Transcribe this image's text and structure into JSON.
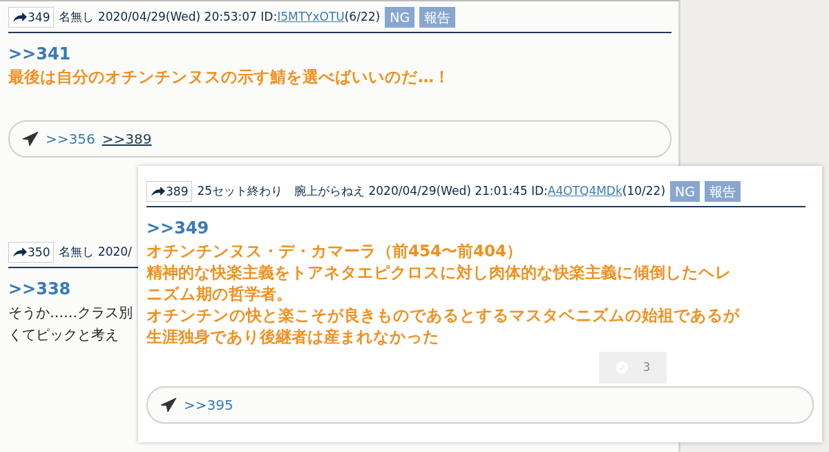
{
  "posts": [
    {
      "number": "349",
      "header": "名無し 2020/04/29(Wed) 20:53:07 ID:",
      "id": "I5MTYxOTU",
      "id_count": "(6/22)",
      "buttons": [
        "NG",
        "報告"
      ],
      "quote": ">>341",
      "kind": "highlight",
      "body": [
        "最後は自分のオチンチンヌスの示す鯖を選べばいいのだ…！"
      ],
      "replies": [
        {
          "label": ">>356",
          "active": false
        },
        {
          "label": ">>389",
          "active": true
        }
      ]
    },
    {
      "number": "350",
      "header": "名無し 2020/",
      "quote": ">>338",
      "kind": "plain",
      "body": [
        "そうか……クラス別",
        "くてピックと考え"
      ]
    }
  ],
  "popup": {
    "number": "389",
    "header": "25セット終わり　腕上がらねえ 2020/04/29(Wed) 21:01:45 ID:",
    "id": "A4OTQ4MDk",
    "id_count": "(10/22)",
    "buttons": [
      "NG",
      "報告"
    ],
    "quote": ">>349",
    "kind": "highlight",
    "body": [
      "オチンチンヌス・デ・カマーラ（前454〜前404）",
      "精神的な快楽主義をトアネタエピクロスに対し肉体的な快楽主義に傾倒したヘレ",
      "ニズム期の哲学者。",
      "オチンチンの快と楽こそが良きものであるとするマスタベニズムの始祖であるが",
      "生涯独身であり後継者は産まれなかった"
    ],
    "votes": "3",
    "replies": [
      {
        "label": ">>395",
        "active": false
      }
    ]
  }
}
